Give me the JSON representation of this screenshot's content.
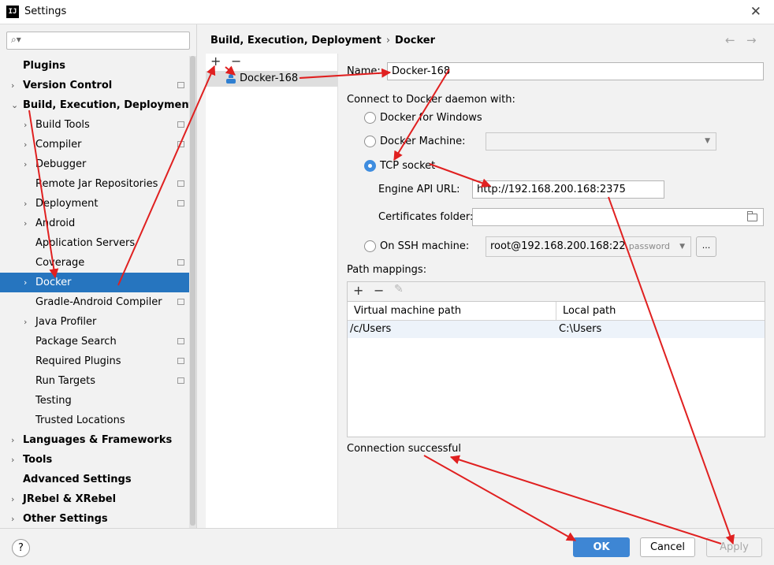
{
  "window": {
    "title": "Settings",
    "app_icon": "IJ",
    "close_glyph": "✕"
  },
  "sidebar": {
    "search": {
      "value": "",
      "placeholder": ""
    },
    "items": [
      {
        "label": "Plugins",
        "level": 0,
        "bold": true,
        "expander": "none",
        "marker": false
      },
      {
        "label": "Version Control",
        "level": 0,
        "bold": true,
        "expander": "collapsed",
        "marker": true
      },
      {
        "label": "Build, Execution, Deployment",
        "level": 0,
        "bold": true,
        "expander": "expanded",
        "marker": false
      },
      {
        "label": "Build Tools",
        "level": 1,
        "bold": false,
        "expander": "collapsed",
        "marker": true
      },
      {
        "label": "Compiler",
        "level": 1,
        "bold": false,
        "expander": "collapsed",
        "marker": true
      },
      {
        "label": "Debugger",
        "level": 1,
        "bold": false,
        "expander": "collapsed",
        "marker": false
      },
      {
        "label": "Remote Jar Repositories",
        "level": 1,
        "bold": false,
        "expander": "none",
        "marker": true
      },
      {
        "label": "Deployment",
        "level": 1,
        "bold": false,
        "expander": "collapsed",
        "marker": true
      },
      {
        "label": "Android",
        "level": 1,
        "bold": false,
        "expander": "collapsed",
        "marker": false
      },
      {
        "label": "Application Servers",
        "level": 1,
        "bold": false,
        "expander": "none",
        "marker": false
      },
      {
        "label": "Coverage",
        "level": 1,
        "bold": false,
        "expander": "none",
        "marker": true
      },
      {
        "label": "Docker",
        "level": 1,
        "bold": false,
        "expander": "collapsed",
        "marker": false,
        "selected": true
      },
      {
        "label": "Gradle-Android Compiler",
        "level": 1,
        "bold": false,
        "expander": "none",
        "marker": true
      },
      {
        "label": "Java Profiler",
        "level": 1,
        "bold": false,
        "expander": "collapsed",
        "marker": false
      },
      {
        "label": "Package Search",
        "level": 1,
        "bold": false,
        "expander": "none",
        "marker": true
      },
      {
        "label": "Required Plugins",
        "level": 1,
        "bold": false,
        "expander": "none",
        "marker": true
      },
      {
        "label": "Run Targets",
        "level": 1,
        "bold": false,
        "expander": "none",
        "marker": true
      },
      {
        "label": "Testing",
        "level": 1,
        "bold": false,
        "expander": "none",
        "marker": false
      },
      {
        "label": "Trusted Locations",
        "level": 1,
        "bold": false,
        "expander": "none",
        "marker": false
      },
      {
        "label": "Languages & Frameworks",
        "level": 0,
        "bold": true,
        "expander": "collapsed",
        "marker": false
      },
      {
        "label": "Tools",
        "level": 0,
        "bold": true,
        "expander": "collapsed",
        "marker": false
      },
      {
        "label": "Advanced Settings",
        "level": 0,
        "bold": true,
        "expander": "none",
        "marker": false
      },
      {
        "label": "JRebel & XRebel",
        "level": 0,
        "bold": true,
        "expander": "collapsed",
        "marker": false
      },
      {
        "label": "Other Settings",
        "level": 0,
        "bold": true,
        "expander": "collapsed",
        "marker": false
      }
    ]
  },
  "breadcrumb": {
    "parent": "Build, Execution, Deployment",
    "separator": "›",
    "current": "Docker"
  },
  "nav": {
    "back": "←",
    "forward": "→"
  },
  "config_list": {
    "add": "+",
    "remove": "−",
    "items": [
      {
        "label": "Docker-168"
      }
    ]
  },
  "form": {
    "name_label": "Name:",
    "name_value": "Docker-168",
    "connect_label": "Connect to Docker daemon with:",
    "options": {
      "docker_for_windows": "Docker for Windows",
      "docker_machine": "Docker Machine:",
      "tcp_socket": "TCP socket",
      "ssh_machine": "On SSH machine:"
    },
    "selected_option": "tcp_socket",
    "docker_machine_value": "",
    "engine_api_label": "Engine API URL:",
    "engine_api_value": "http://192.168.200.168:2375",
    "certs_label": "Certificates folder:",
    "certs_value": "",
    "ssh_value": "root@192.168.200.168:22",
    "ssh_sub": "password",
    "ssh_more": "...",
    "path_mappings_label": "Path mappings:",
    "path_tools": {
      "add": "+",
      "remove": "−",
      "edit": "✎"
    },
    "table": {
      "headers": [
        "Virtual machine path",
        "Local path"
      ],
      "rows": [
        [
          "/c/Users",
          "C:\\Users"
        ]
      ]
    },
    "status": "Connection successful"
  },
  "footer": {
    "help": "?",
    "ok": "OK",
    "cancel": "Cancel",
    "apply": "Apply"
  },
  "colors": {
    "selection": "#2675bf",
    "primary_button": "#3e86d4",
    "annotation_arrow": "#e02020",
    "radio_on": "#3f8ddf"
  }
}
